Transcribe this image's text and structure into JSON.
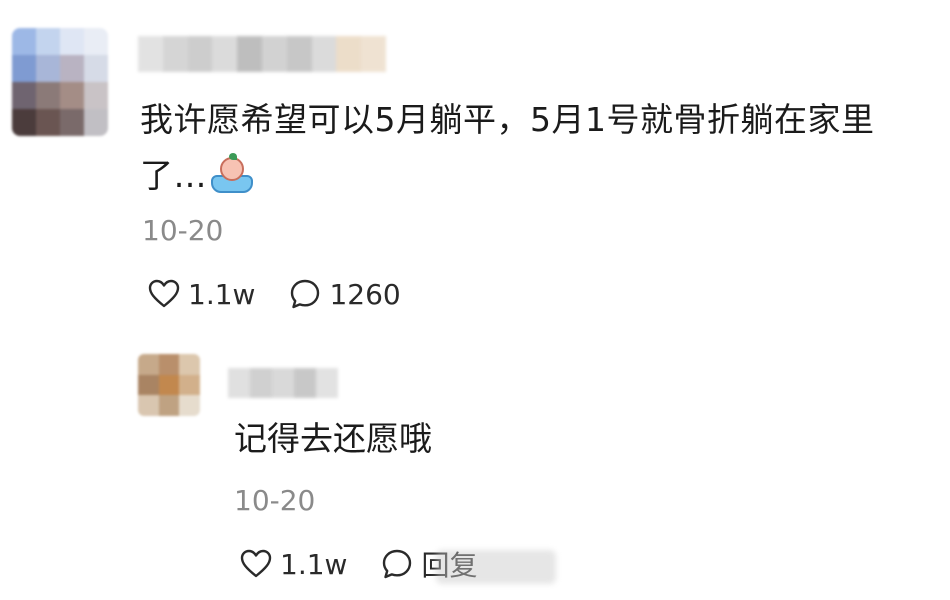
{
  "comment": {
    "text": "我许愿希望可以5月躺平，5月1号就骨折躺在家里了…",
    "emoji": "crying-in-tub-sticker",
    "date": "10-20",
    "likes": "1.1w",
    "replies_count": "1260",
    "avatar_pixels": [
      "#9db8e6",
      "#c3d4ee",
      "#dfe6f4",
      "#e9edf5",
      "#7f9bd2",
      "#a8b6d8",
      "#b9b3c2",
      "#d6dbe7",
      "#6f6470",
      "#8b7a78",
      "#a48d86",
      "#c9c3c6",
      "#4b3c3c",
      "#6a5552",
      "#7a6a6a",
      "#c1bfc4"
    ],
    "username_pixels": [
      "#d9d9d9",
      "#c8c8c8",
      "#bdbdbd",
      "#d0d0d0",
      "#a9a9a9",
      "#c4c4c4",
      "#b5b5b5",
      "#cfcfcf",
      "#e6d2b8",
      "#ead9c4"
    ]
  },
  "reply": {
    "text": "记得去还愿哦",
    "date": "10-20",
    "likes": "1.1w",
    "reply_label": "回复",
    "avatar_pixels": [
      "#c6a98a",
      "#b98f6b",
      "#dcc7ad",
      "#a98463",
      "#c2884e",
      "#d2b08b",
      "#d9c6b0",
      "#bfa282",
      "#e6dccd"
    ],
    "username_pixels": [
      "#d3d3d3",
      "#bdbdbd",
      "#c9c9c9",
      "#b2b2b2",
      "#d6d6d6"
    ]
  }
}
